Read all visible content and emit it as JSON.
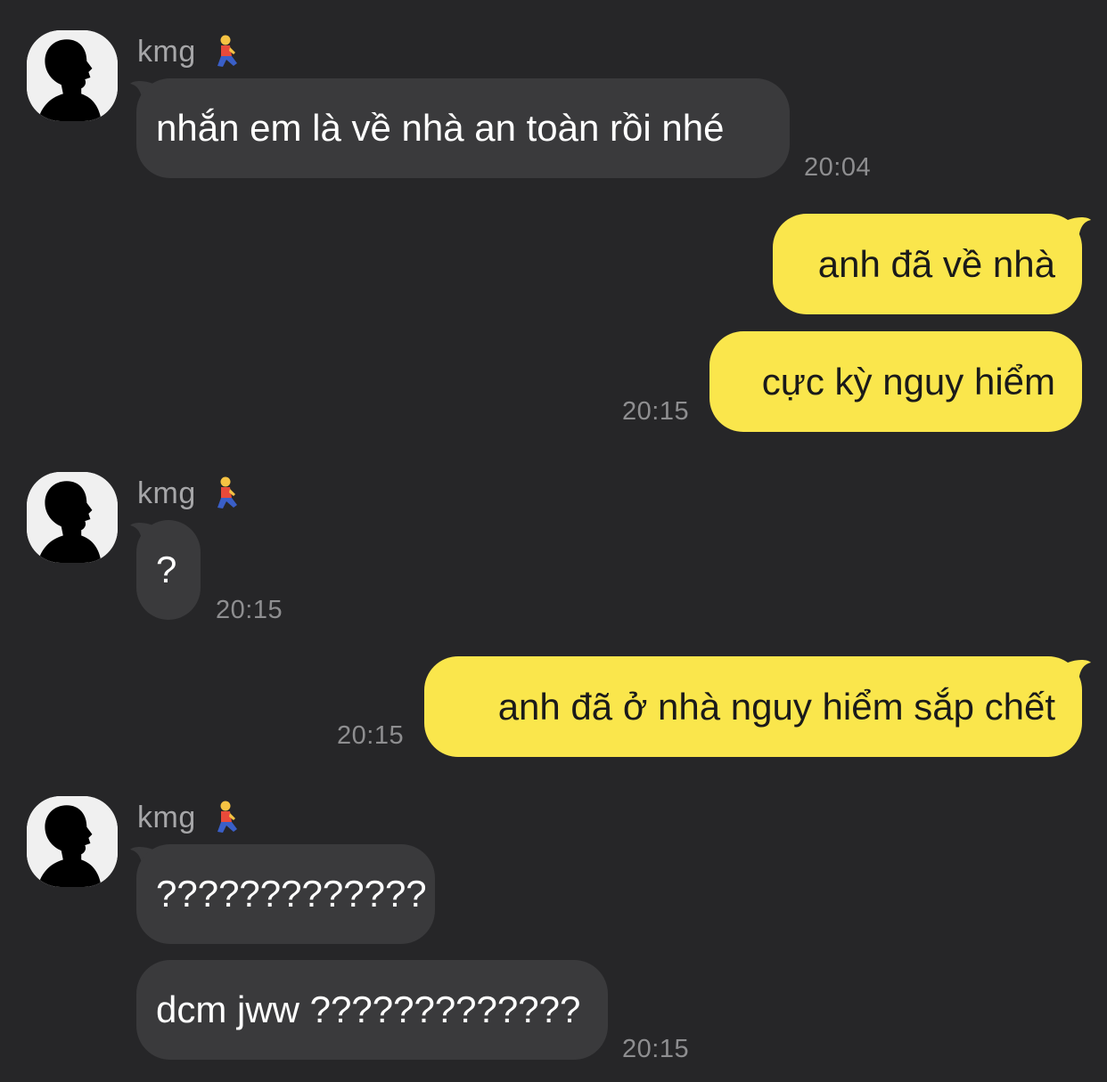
{
  "theme": {
    "background": "#262628",
    "incoming_bubble": "#3a3a3c",
    "outgoing_bubble": "#fae64c",
    "timestamp_color": "#8e8e90",
    "name_color": "#a6a6a8"
  },
  "contact": {
    "name": "kmg",
    "avatar_icon": "silhouette-avatar-icon",
    "status_emoji_icon": "kneeling-person-emoji-icon"
  },
  "messages": [
    {
      "direction": "incoming",
      "text": "nhắn em là về nhà an toàn rồi nhé",
      "time": "20:04"
    },
    {
      "direction": "outgoing",
      "text": "anh đã về nhà"
    },
    {
      "direction": "outgoing",
      "text": "cực kỳ nguy hiểm",
      "time": "20:15"
    },
    {
      "direction": "incoming",
      "text": "?",
      "time": "20:15"
    },
    {
      "direction": "outgoing",
      "text": "anh đã ở nhà nguy hiểm sắp chết",
      "time": "20:15"
    },
    {
      "direction": "incoming",
      "text": "?????????????"
    },
    {
      "direction": "incoming",
      "text": "dcm jww ?????????????",
      "time": "20:15"
    }
  ]
}
